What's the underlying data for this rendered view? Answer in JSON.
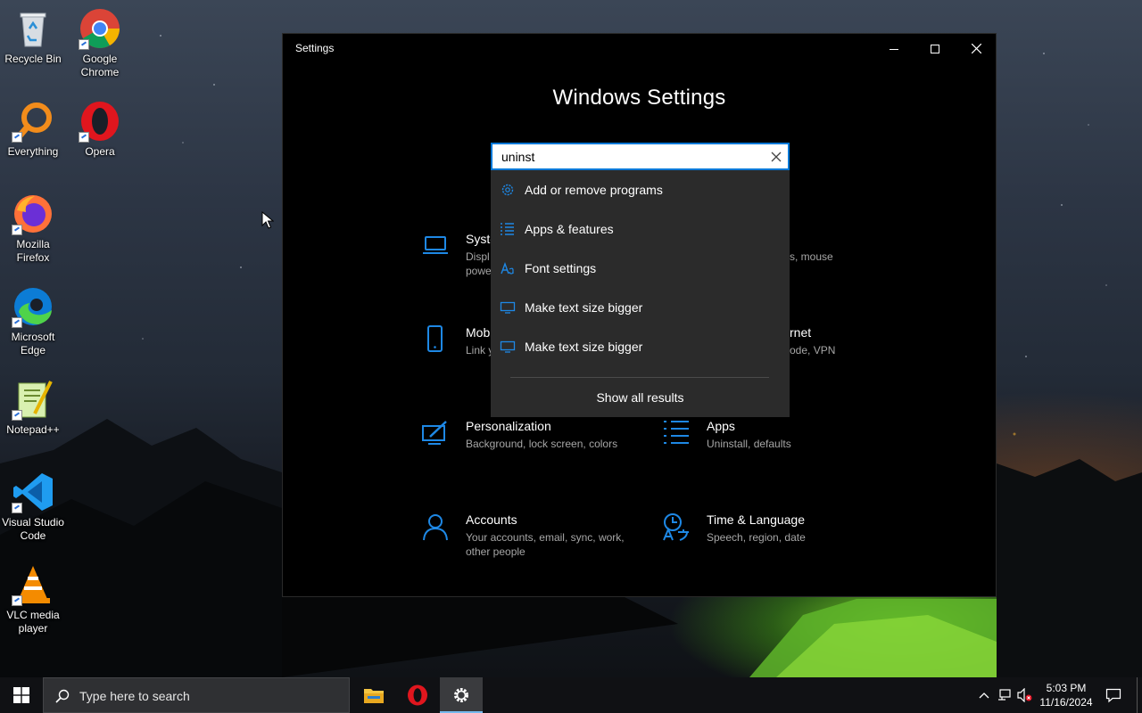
{
  "desktop": {
    "icons": [
      {
        "label_1": "Recycle Bin",
        "label_2": ""
      },
      {
        "label_1": "Google",
        "label_2": "Chrome"
      },
      {
        "label_1": "Everything",
        "label_2": ""
      },
      {
        "label_1": "Opera",
        "label_2": ""
      },
      {
        "label_1": "Mozilla",
        "label_2": "Firefox"
      },
      {
        "label_1": "Microsoft",
        "label_2": "Edge"
      },
      {
        "label_1": "Notepad++",
        "label_2": ""
      },
      {
        "label_1": "Visual Studio",
        "label_2": "Code"
      },
      {
        "label_1": "VLC media",
        "label_2": "player"
      }
    ]
  },
  "window": {
    "title": "Settings",
    "heading": "Windows Settings",
    "controls": {
      "minimize": "minimize-icon",
      "maximize": "maximize-icon",
      "close": "close-icon"
    }
  },
  "search": {
    "value": "uninst",
    "clear_icon": "close-icon",
    "results": [
      {
        "label": "Add or remove programs",
        "icon": "gear-icon"
      },
      {
        "label": "Apps & features",
        "icon": "list-icon"
      },
      {
        "label": "Font settings",
        "icon": "font-icon"
      },
      {
        "label": "Make text size bigger",
        "icon": "monitor-icon"
      },
      {
        "label": "Make text size bigger",
        "icon": "monitor-icon"
      }
    ],
    "show_all": "Show all results"
  },
  "categories": {
    "system": {
      "title": "Syste",
      "desc": "Displ\npowe"
    },
    "devices": {
      "desc": "s, mouse"
    },
    "phone": {
      "title": "Mob",
      "desc": "Link y"
    },
    "network": {
      "title": "rnet",
      "desc": "ode, VPN"
    },
    "personalization": {
      "title": "Personalization",
      "desc": "Background, lock screen, colors"
    },
    "apps": {
      "title": "Apps",
      "desc": "Uninstall, defaults"
    },
    "accounts": {
      "title": "Accounts",
      "desc": "Your accounts, email, sync, work, other people"
    },
    "time": {
      "title": "Time & Language",
      "desc": "Speech, region, date"
    }
  },
  "taskbar": {
    "search_placeholder": "Type here to search",
    "time": "5:03 PM",
    "date": "11/16/2024"
  },
  "colors": {
    "accent": "#0078d7",
    "icon_blue": "#1e88e5"
  }
}
